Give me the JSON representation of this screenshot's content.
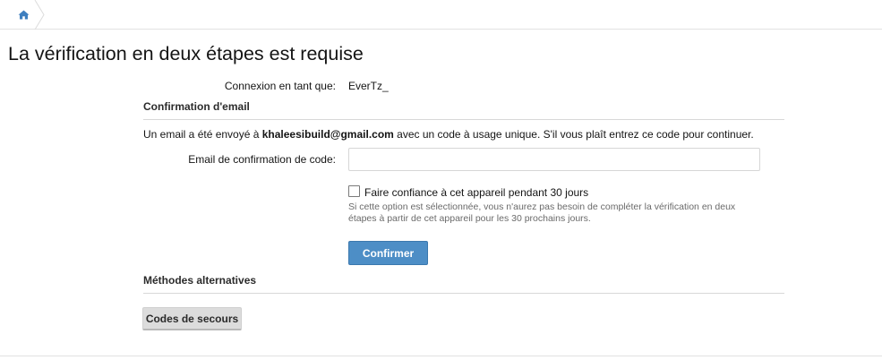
{
  "breadcrumb": {
    "home_icon": "home-icon"
  },
  "page": {
    "title": "La vérification en deux étapes est requise"
  },
  "login": {
    "label": "Connexion en tant que:",
    "username": "EverTz_"
  },
  "email_section": {
    "heading": "Confirmation d'email",
    "info_prefix": "Un email a été envoyé à ",
    "email": "khaleesibuild@gmail.com",
    "info_suffix": " avec un code à usage unique. S'il vous plaît entrez ce code pour continuer.",
    "code_label": "Email de confirmation de code:",
    "code_value": "",
    "code_placeholder": ""
  },
  "trust": {
    "label": "Faire confiance à cet appareil pendant 30 jours",
    "hint": "Si cette option est sélectionnée, vous n'aurez pas besoin de compléter la vérification en deux étapes à partir de cet appareil pour les 30 prochains jours.",
    "checked": false
  },
  "actions": {
    "confirm_label": "Confirmer"
  },
  "alternatives": {
    "heading": "Méthodes alternatives",
    "backup_label": "Codes de secours"
  },
  "colors": {
    "primary": "#4d8ec6",
    "home_icon": "#3f7fbf",
    "secondary_button": "#dcdcdc"
  }
}
